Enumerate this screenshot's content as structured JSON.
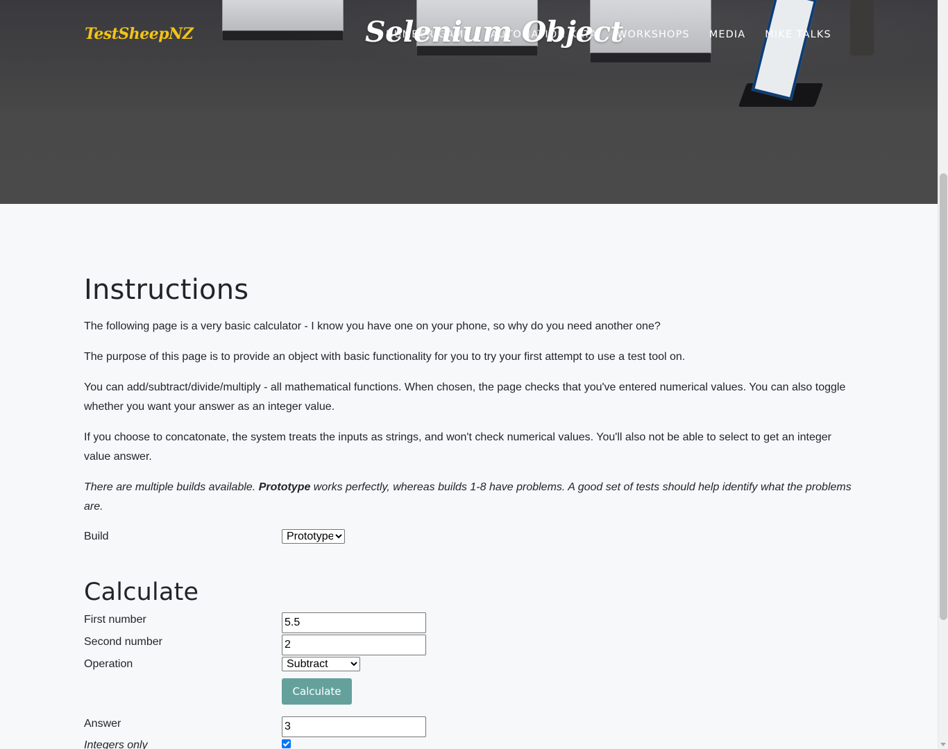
{
  "brand": "TestSheepNZ",
  "page_heading": "Selenium Object",
  "nav": [
    "NUMBER GAME",
    "AUTOMATION KATA",
    "WORKSHOPS",
    "MEDIA",
    "MIKE TALKS"
  ],
  "instructions": {
    "heading": "Instructions",
    "p1": "The following page is a very basic calculator - I know you have one on your phone, so why do you need another one?",
    "p2": "The purpose of this page is to provide an object with basic functionality for you to try your first attempt to use a test tool on.",
    "p3": "You can add/subtract/divide/multiply - all mathematical functions. When chosen, the page checks that you've entered numerical values. You can also toggle whether you want your answer as an integer value.",
    "p4": "If you choose to concatonate, the system treats the inputs as strings, and won't check numerical values. You'll also not be able to select to get an integer value answer.",
    "p5_start": "There are multiple builds available. ",
    "p5_bold": "Prototype",
    "p5_end": " works perfectly, whereas builds 1-8 have problems. A good set of tests should help identify what the problems are."
  },
  "build": {
    "label": "Build",
    "selected": "Prototype"
  },
  "calculate": {
    "heading": "Calculate",
    "first_label": "First number",
    "first_value": "5.5",
    "second_label": "Second number",
    "second_value": "2",
    "operation_label": "Operation",
    "operation_selected": "Subtract",
    "button_label": "Calculate",
    "answer_label": "Answer",
    "answer_value": "3",
    "integers_label": "Integers only",
    "integers_checked": true
  },
  "colors": {
    "brand": "#f3c316",
    "button": "#64a19d",
    "page_bg": "#f7f8fa"
  }
}
